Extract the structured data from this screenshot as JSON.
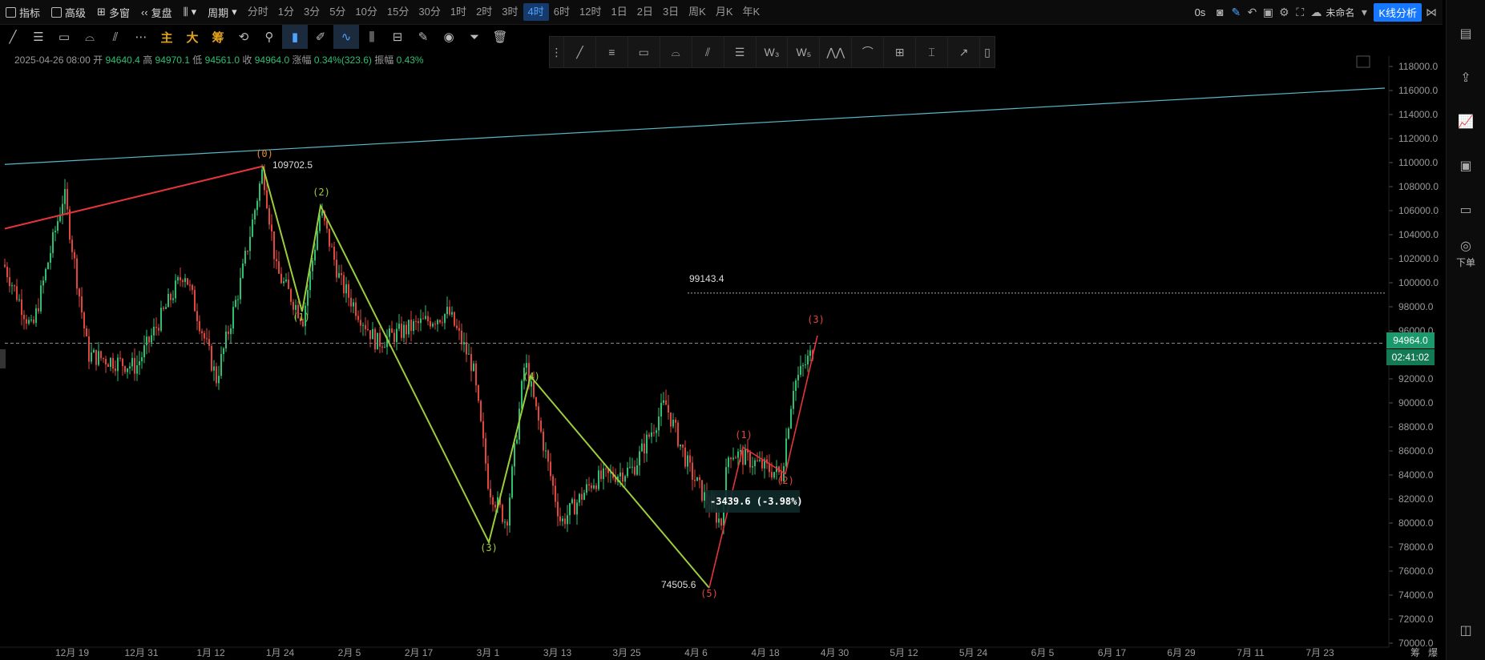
{
  "topbar": {
    "indicators": "指标",
    "advanced": "高级",
    "multi_window": "多窗",
    "replay": "复盘",
    "period_label": "周期",
    "periods": [
      "分时",
      "1分",
      "3分",
      "5分",
      "10分",
      "15分",
      "30分",
      "1时",
      "2时",
      "3时",
      "4时",
      "6时",
      "12时",
      "1日",
      "2日",
      "3日",
      "周K",
      "月K",
      "年K"
    ],
    "active_period": "4时",
    "countdown": "0s",
    "unnamed": "未命名",
    "kline_analysis": "K线分析"
  },
  "toolbar2": {
    "cn_tools": [
      "主",
      "大",
      "筹"
    ]
  },
  "info": {
    "datetime": "2025-04-26 08:00",
    "open_label": "开",
    "open": "94640.4",
    "high_label": "高",
    "high": "94970.1",
    "low_label": "低",
    "low": "94561.0",
    "close_label": "收",
    "close": "94964.0",
    "change_label": "涨幅",
    "change": "0.34%(323.6)",
    "amp_label": "振幅",
    "amp": "0.43%"
  },
  "chart_data": {
    "type": "candlestick",
    "y_ticks": [
      "118000.0",
      "116000.0",
      "114000.0",
      "112000.0",
      "110000.0",
      "108000.0",
      "106000.0",
      "104000.0",
      "102000.0",
      "100000.0",
      "98000.0",
      "96000.0",
      "94000.0",
      "92000.0",
      "90000.0",
      "88000.0",
      "86000.0",
      "84000.0",
      "82000.0",
      "80000.0",
      "78000.0",
      "76000.0",
      "74000.0",
      "72000.0",
      "70000.0"
    ],
    "ylim": [
      70000,
      118000
    ],
    "x_ticks": [
      "12月 19",
      "12月 31",
      "1月 12",
      "1月 24",
      "2月 5",
      "2月 17",
      "3月 1",
      "3月 13",
      "3月 25",
      "4月 6",
      "4月 18",
      "4月 30",
      "5月 12",
      "5月 24",
      "6月 5",
      "6月 17",
      "6月 29",
      "7月 11",
      "7月 23"
    ],
    "last_price": "94964.0",
    "countdown": "02:41:02",
    "annotations": {
      "peak_value": "109702.5",
      "level_value": "99143.4",
      "low_value": "74505.6",
      "measure": "-3439.6 (-3.98%)"
    },
    "wave_labels": [
      {
        "text": "(0)",
        "color": "#e08a3c"
      },
      {
        "text": "(1)",
        "color": "#9ccd3a"
      },
      {
        "text": "(2)",
        "color": "#9ccd3a"
      },
      {
        "text": "(3)",
        "color": "#9ccd3a"
      },
      {
        "text": "(4)",
        "color": "#9ccd3a"
      },
      {
        "text": "(5)",
        "color": "#e0463c"
      },
      {
        "text": "(1)",
        "color": "#e0463c"
      },
      {
        "text": "(2)",
        "color": "#e0463c"
      },
      {
        "text": "(3)",
        "color": "#e0463c"
      }
    ],
    "colors": {
      "up": "#2fbf71",
      "down": "#e0463c",
      "trend": "#5ab6c8",
      "wave": "#9ccd3a",
      "redline": "#e5343a"
    }
  },
  "rightbar": {
    "order_label": "下单"
  },
  "bottom_right": [
    "筹",
    "爆"
  ]
}
